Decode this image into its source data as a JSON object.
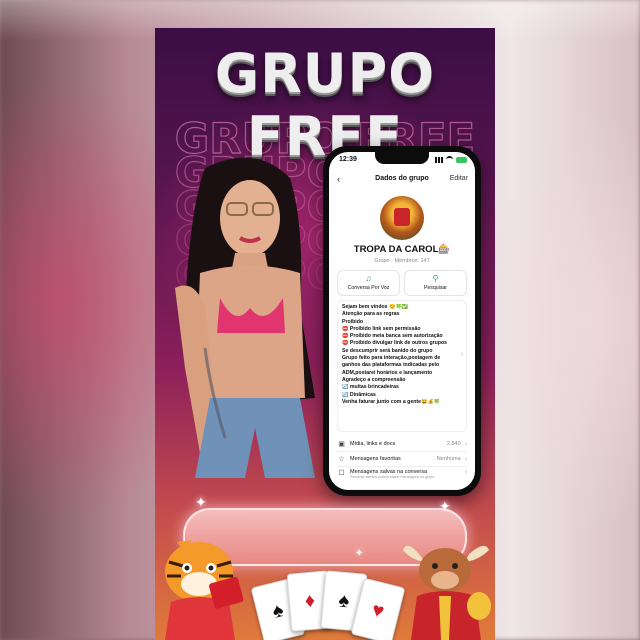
{
  "poster": {
    "title": "GRUPO FREE",
    "colors": {
      "accent": "#8b1f5a",
      "dark": "#3a0e44",
      "whatsapp_green": "#25a36a"
    }
  },
  "phone": {
    "status_time": "12:39",
    "nav": {
      "back_icon": "chevron-left-icon",
      "title": "Dados do grupo",
      "edit_label": "Editar"
    },
    "group": {
      "name": "TROPA DA CAROL🎰",
      "subtitle": "Grupo · Membros: 147"
    },
    "actions": [
      {
        "icon": "voice-wave-icon",
        "label": "Conversa Por Voz"
      },
      {
        "icon": "search-icon",
        "label": "Pesquisar"
      }
    ],
    "description_lines": [
      "Sejam bem vindos 😊🍀✅",
      "Atenção para as regras",
      "Proibido",
      "⛔ Proibido link sem permissão",
      "⛔ Proibido meia banca sem autorização",
      "⛔ Proibido divulgar link de outros grupos",
      "Se descumprir será banido do grupo",
      "Grupo feito para interação,postagem de",
      "ganhos das plataformas indicadas pelo",
      "ADM,postarei horários e lançamento",
      "Agradeço a compreensão",
      "🔄 muitas brincadeiras",
      "🔄 Dinâmicas",
      "Venha faturar junto com a gente😄💰🍀"
    ],
    "rows": [
      {
        "icon": "media-icon",
        "label": "Mídia, links e docs",
        "value": "2.840"
      },
      {
        "icon": "star-icon",
        "label": "Mensagens favoritas",
        "value": "Nenhuma"
      },
      {
        "icon": "saved-messages-icon",
        "label": "Mensagens salvas na conversa",
        "value": "",
        "note": "Somente admins podem salvar mensagens no grupo."
      }
    ]
  }
}
